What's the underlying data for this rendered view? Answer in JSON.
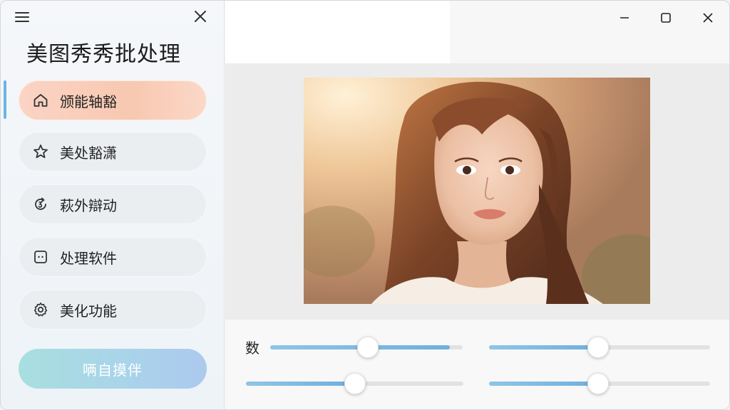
{
  "app": {
    "title": "美图秀秀批处理"
  },
  "sidebar": {
    "menu_icon": "hamburger-icon",
    "close_icon": "close-icon",
    "items": [
      {
        "label": "颁能轴豁",
        "icon": "home-icon",
        "active": true
      },
      {
        "label": "美处豁潇",
        "icon": "star-icon",
        "active": false
      },
      {
        "label": "萩外辯动",
        "icon": "refresh-icon",
        "active": false
      },
      {
        "label": "处理软件",
        "icon": "dots-square-icon",
        "active": false
      },
      {
        "label": "美化功能",
        "icon": "gear-icon",
        "active": false
      }
    ],
    "cta_label": "唡自摸伴"
  },
  "window_controls": {
    "minimize_icon": "minimize-icon",
    "maximize_icon": "maximize-icon",
    "close_icon": "close-icon"
  },
  "preview": {
    "image": "portrait-photo"
  },
  "controls": {
    "label": "数",
    "sliders": [
      {
        "value": 0.5
      },
      {
        "value": 0.5
      },
      {
        "value": 0.5
      },
      {
        "value": 0.5
      }
    ]
  },
  "colors": {
    "accent": "#6ab5e0",
    "active_item": "#f8c8b0",
    "cta": "#a9d3ea"
  }
}
